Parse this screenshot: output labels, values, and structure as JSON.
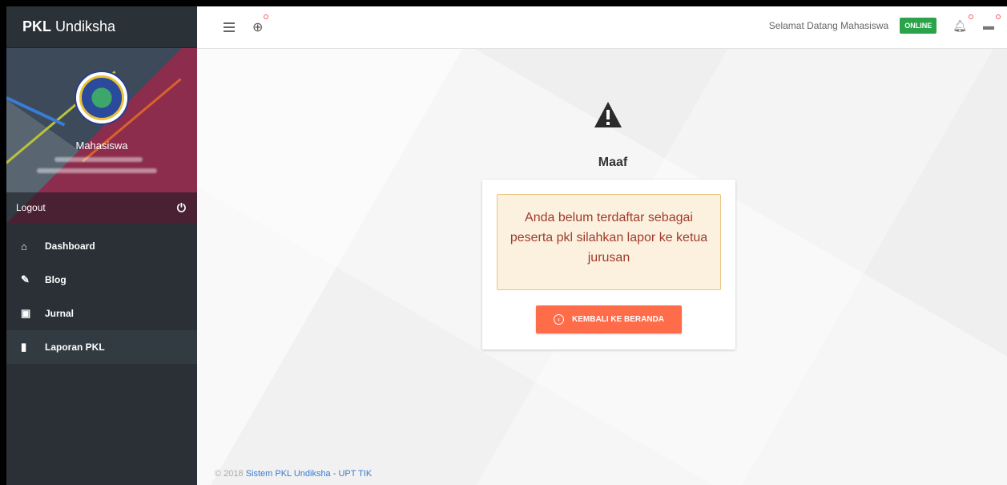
{
  "brand": {
    "bold": "PKL",
    "rest": "Undiksha"
  },
  "profile": {
    "name": "Mahasiswa",
    "logout_label": "Logout"
  },
  "menu": [
    {
      "label": "Dashboard",
      "icon": "home-icon"
    },
    {
      "label": "Blog",
      "icon": "pencil-icon"
    },
    {
      "label": "Jurnal",
      "icon": "save-icon"
    },
    {
      "label": "Laporan PKL",
      "icon": "book-icon",
      "active": true
    }
  ],
  "topbar": {
    "welcome": "Selamat Datang Mahasiswa",
    "status_badge": "ONLINE"
  },
  "main": {
    "title": "Maaf",
    "alert": "Anda belum terdaftar sebagai peserta pkl silahkan lapor ke ketua jurusan",
    "button": "KEMBALI KE BERANDA"
  },
  "footer": {
    "prefix": "© 2018 ",
    "link": "Sistem PKL Undiksha - UPT TIK"
  },
  "colors": {
    "sidebar": "#2a3036",
    "accent": "#ff6c4a",
    "online": "#2ba34a",
    "alert_bg": "#fcf1df",
    "alert_text": "#a13b2c"
  }
}
